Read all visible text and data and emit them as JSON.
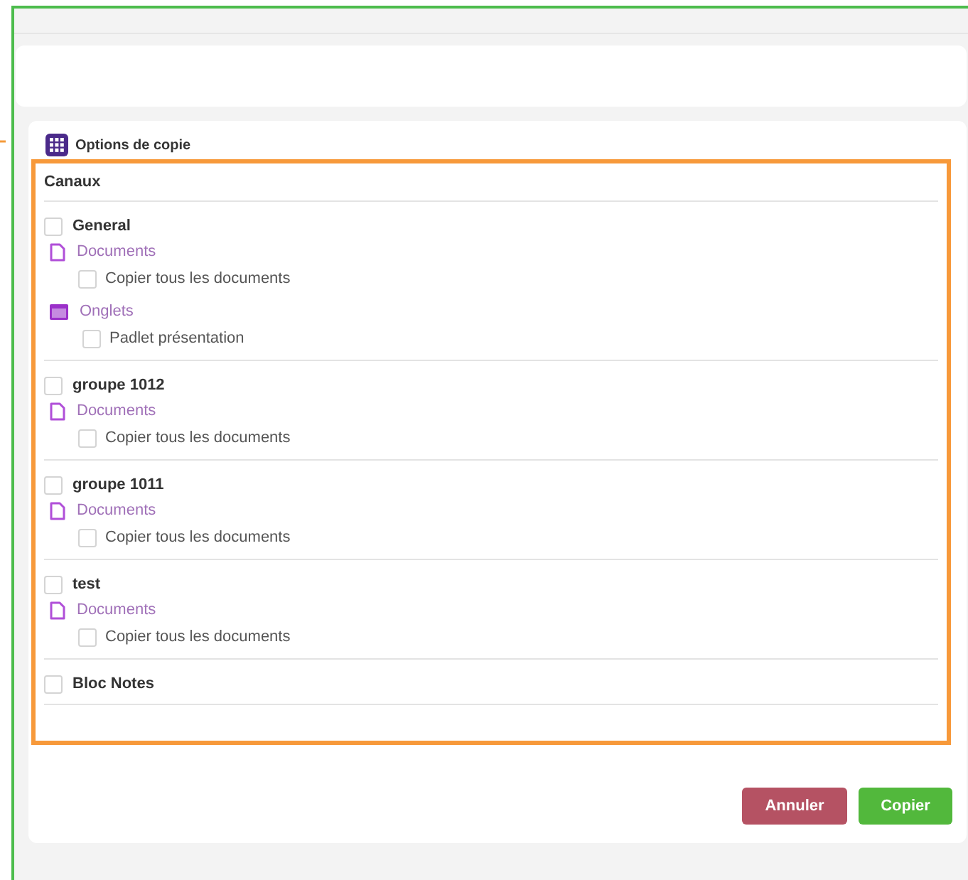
{
  "section": {
    "title": "Options de copie"
  },
  "channels_title": "Canaux",
  "channels": [
    {
      "name": "General",
      "checked": false,
      "groups": [
        {
          "kind": "documents",
          "label": "Documents",
          "items": [
            {
              "label": "Copier tous les documents",
              "checked": false
            }
          ]
        },
        {
          "kind": "tabs",
          "label": "Onglets",
          "items": [
            {
              "label": "Padlet présentation",
              "checked": false
            }
          ]
        }
      ]
    },
    {
      "name": "groupe 1012",
      "checked": false,
      "groups": [
        {
          "kind": "documents",
          "label": "Documents",
          "items": [
            {
              "label": "Copier tous les documents",
              "checked": false
            }
          ]
        }
      ]
    },
    {
      "name": "groupe 1011",
      "checked": false,
      "groups": [
        {
          "kind": "documents",
          "label": "Documents",
          "items": [
            {
              "label": "Copier tous les documents",
              "checked": false
            }
          ]
        }
      ]
    },
    {
      "name": "test",
      "checked": false,
      "groups": [
        {
          "kind": "documents",
          "label": "Documents",
          "items": [
            {
              "label": "Copier tous les documents",
              "checked": false
            }
          ]
        }
      ]
    },
    {
      "name": "Bloc Notes",
      "checked": false
    }
  ],
  "buttons": [
    {
      "kind": "cancel",
      "label": "Annuler"
    },
    {
      "kind": "confirm",
      "label": "Copier"
    }
  ]
}
